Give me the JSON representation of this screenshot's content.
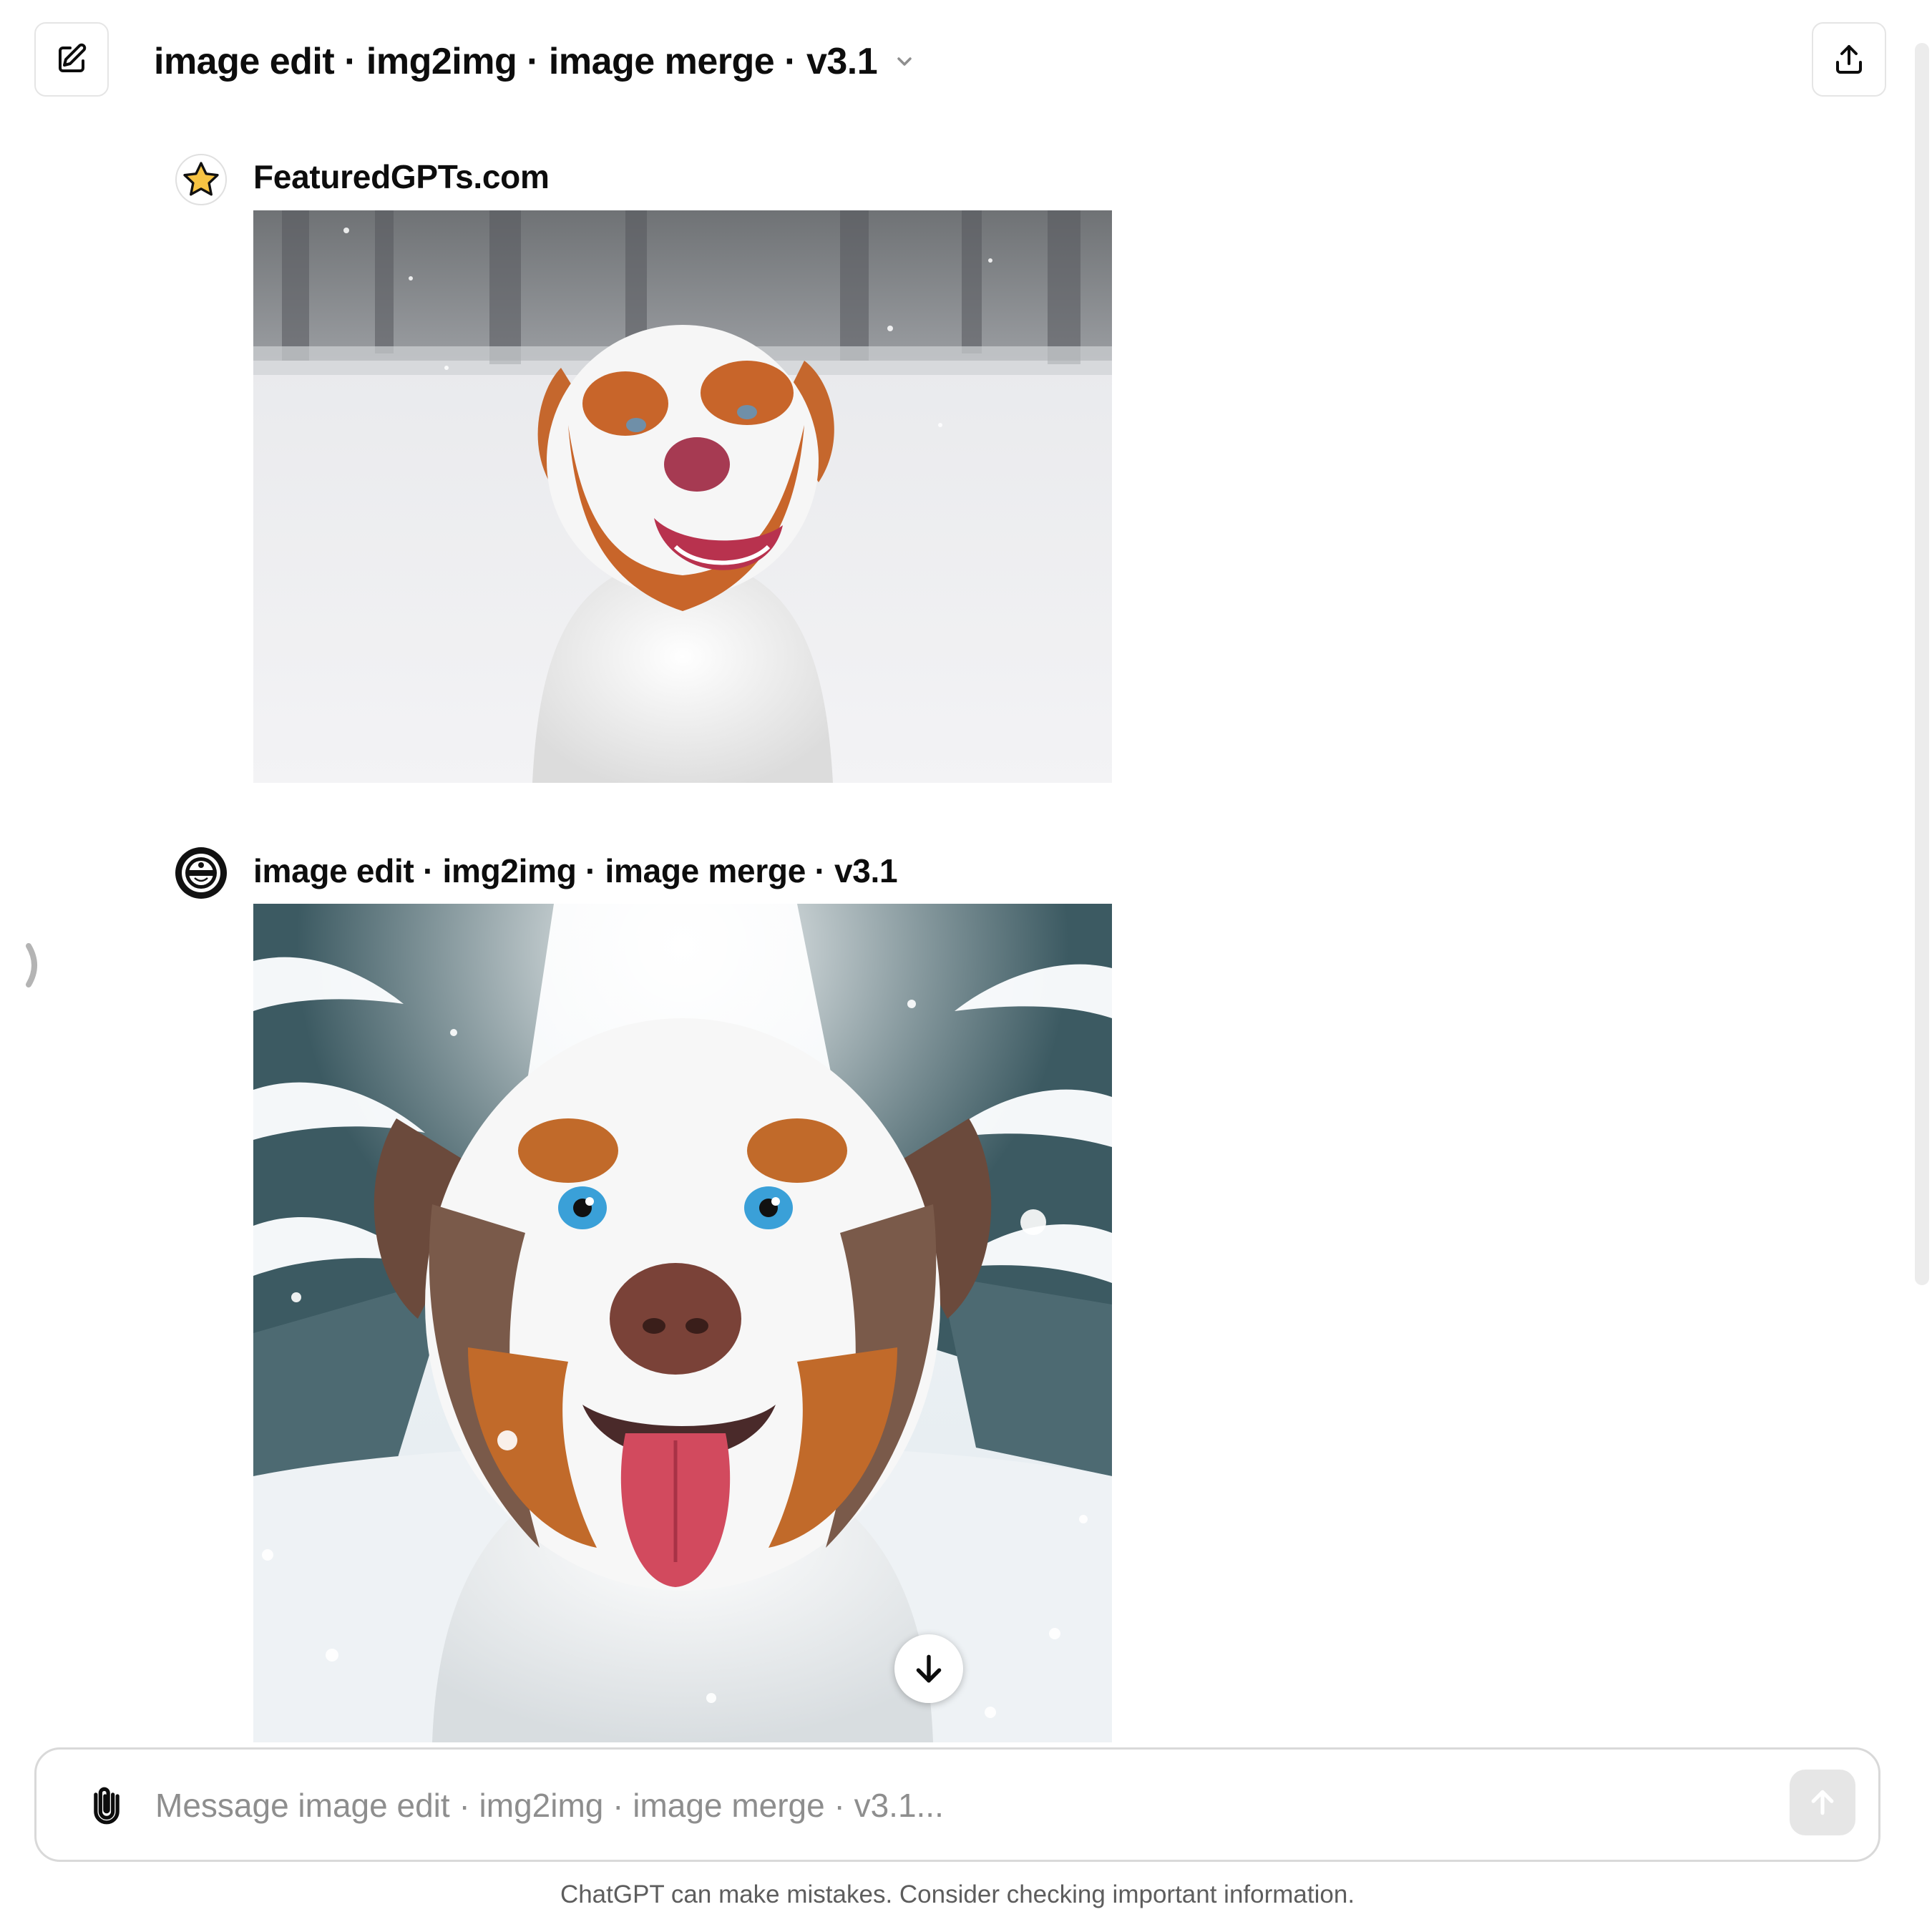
{
  "header": {
    "title": "image edit · img2img · image merge · v3.1",
    "new_chat_icon": "edit-pencil-icon",
    "share_icon": "share-upload-icon",
    "title_chevron_icon": "chevron-down-icon"
  },
  "messages": [
    {
      "sender": "FeaturedGPTs.com",
      "avatar_icon": "star-icon",
      "image": "photo-australian-shepherd-in-snowy-field"
    },
    {
      "sender": "image edit · img2img · image merge · v3.1",
      "avatar_icon": "gpt-logo-icon",
      "image": "generated-australian-shepherd-in-snowy-forest",
      "download_icon": "arrow-down-icon"
    }
  ],
  "composer": {
    "placeholder": "Message image edit · img2img · image merge · v3.1...",
    "value": "",
    "attach_icon": "paperclip-icon",
    "send_icon": "arrow-up-icon"
  },
  "footer": {
    "disclaimer": "ChatGPT can make mistakes. Consider checking important information."
  },
  "colors": {
    "text": "#0d0d0d",
    "border": "#e5e5e5",
    "send_disabled": "#e6e6e6",
    "star": "#f6c343"
  }
}
